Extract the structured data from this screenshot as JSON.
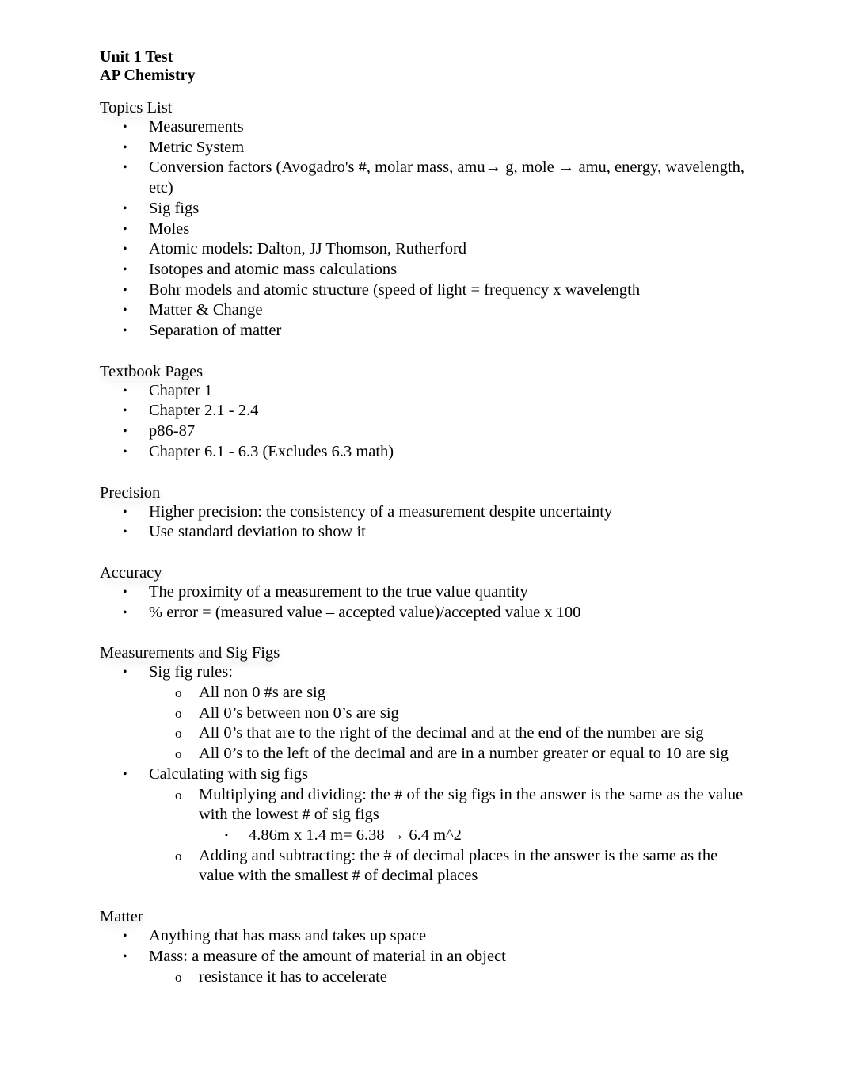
{
  "document": {
    "title_line1": "Unit 1 Test",
    "title_line2": "AP Chemistry",
    "bullets": {
      "level1": "•",
      "level2": "o",
      "level3": "▪"
    },
    "sections": [
      {
        "heading": "Topics List",
        "items": [
          {
            "level": 1,
            "text": "Measurements"
          },
          {
            "level": 1,
            "text": "Metric System"
          },
          {
            "level": 1,
            "text": "Conversion factors (Avogadro's #, molar mass, amu→ g, mole → amu, energy, wavelength, etc)"
          },
          {
            "level": 1,
            "text": "Sig figs"
          },
          {
            "level": 1,
            "text": "Moles"
          },
          {
            "level": 1,
            "text": "Atomic models: Dalton, JJ Thomson, Rutherford"
          },
          {
            "level": 1,
            "text": "Isotopes and atomic mass calculations"
          },
          {
            "level": 1,
            "text": "Bohr models and atomic structure (speed of light = frequency x wavelength"
          },
          {
            "level": 1,
            "text": "Matter & Change"
          },
          {
            "level": 1,
            "text": "Separation of matter"
          }
        ]
      },
      {
        "heading": "Textbook Pages",
        "items": [
          {
            "level": 1,
            "text": "Chapter 1"
          },
          {
            "level": 1,
            "text": "Chapter 2.1 - 2.4"
          },
          {
            "level": 1,
            "text": "p86-87"
          },
          {
            "level": 1,
            "text": "Chapter 6.1 - 6.3 (Excludes 6.3 math)"
          }
        ]
      },
      {
        "heading": "Precision",
        "items": [
          {
            "level": 1,
            "text": "Higher precision: the consistency of a measurement despite uncertainty"
          },
          {
            "level": 1,
            "text": "Use standard deviation to show it"
          }
        ]
      },
      {
        "heading": "Accuracy",
        "items": [
          {
            "level": 1,
            "text": "The proximity of a measurement to the true value quantity"
          },
          {
            "level": 1,
            "text": "% error = (measured value – accepted value)/accepted value x 100"
          }
        ]
      },
      {
        "heading": "Measurements and Sig Figs",
        "items": [
          {
            "level": 1,
            "text": "Sig fig rules:"
          },
          {
            "level": 2,
            "text": "All non 0 #s are sig"
          },
          {
            "level": 2,
            "text": "All 0’s between non 0’s are sig"
          },
          {
            "level": 2,
            "text": "All 0’s that are to the right of the decimal and at the end of the number are sig"
          },
          {
            "level": 2,
            "text": "All 0’s to the left of the decimal and are in a number greater or equal to 10 are sig"
          },
          {
            "level": 1,
            "text": "Calculating with sig figs"
          },
          {
            "level": 2,
            "text": "Multiplying and dividing: the # of the sig figs in the answer is the same as the value with the lowest # of sig figs"
          },
          {
            "level": 3,
            "text": "4.86m x 1.4 m= 6.38 → 6.4 m^2"
          },
          {
            "level": 2,
            "text": "Adding and subtracting: the # of decimal places in the answer is the same as the value with the smallest # of decimal places"
          }
        ]
      },
      {
        "heading": "Matter",
        "items": [
          {
            "level": 1,
            "text": "Anything that has mass and takes up space"
          },
          {
            "level": 1,
            "text": "Mass: a measure of the amount of material in an object"
          },
          {
            "level": 2,
            "text": "resistance it has to accelerate"
          }
        ]
      }
    ]
  }
}
